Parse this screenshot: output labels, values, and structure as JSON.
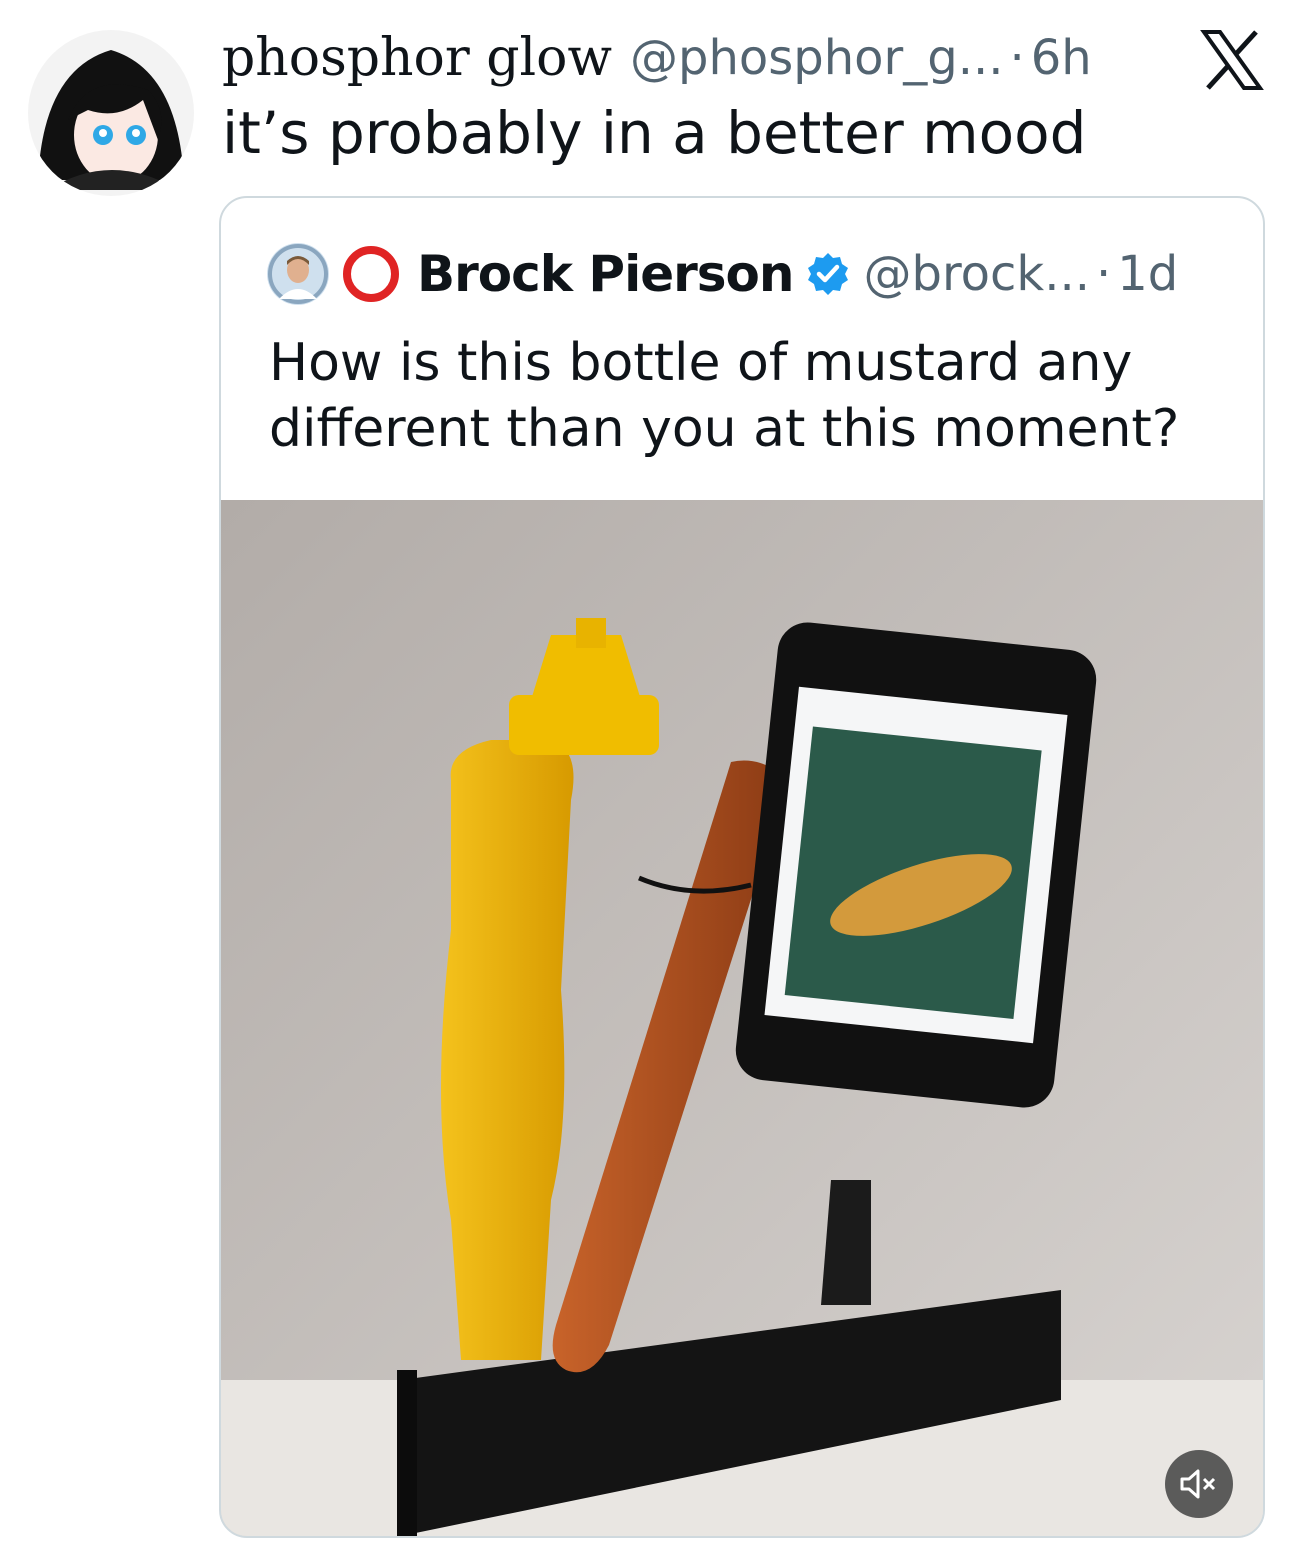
{
  "tweet": {
    "author_name": "phosphor glow",
    "author_handle": "@phosphor_g...",
    "separator": "·",
    "time": "6h",
    "text": "it’s probably in a better mood"
  },
  "quoted_tweet": {
    "author_name": "Brock Pierson",
    "author_handle": "@brock...",
    "separator": "·",
    "time": "1d",
    "text": "How is this bottle of mustard any different than you at this moment?",
    "verified": true
  },
  "icons": {
    "app_logo": "x-logo-icon",
    "verified": "verified-badge-icon",
    "mute": "speaker-muted-icon"
  },
  "colors": {
    "verified": "#1d9bf0",
    "ring": "#e02424",
    "mustard": "#f2b705",
    "wall": "#bdb8b4"
  }
}
